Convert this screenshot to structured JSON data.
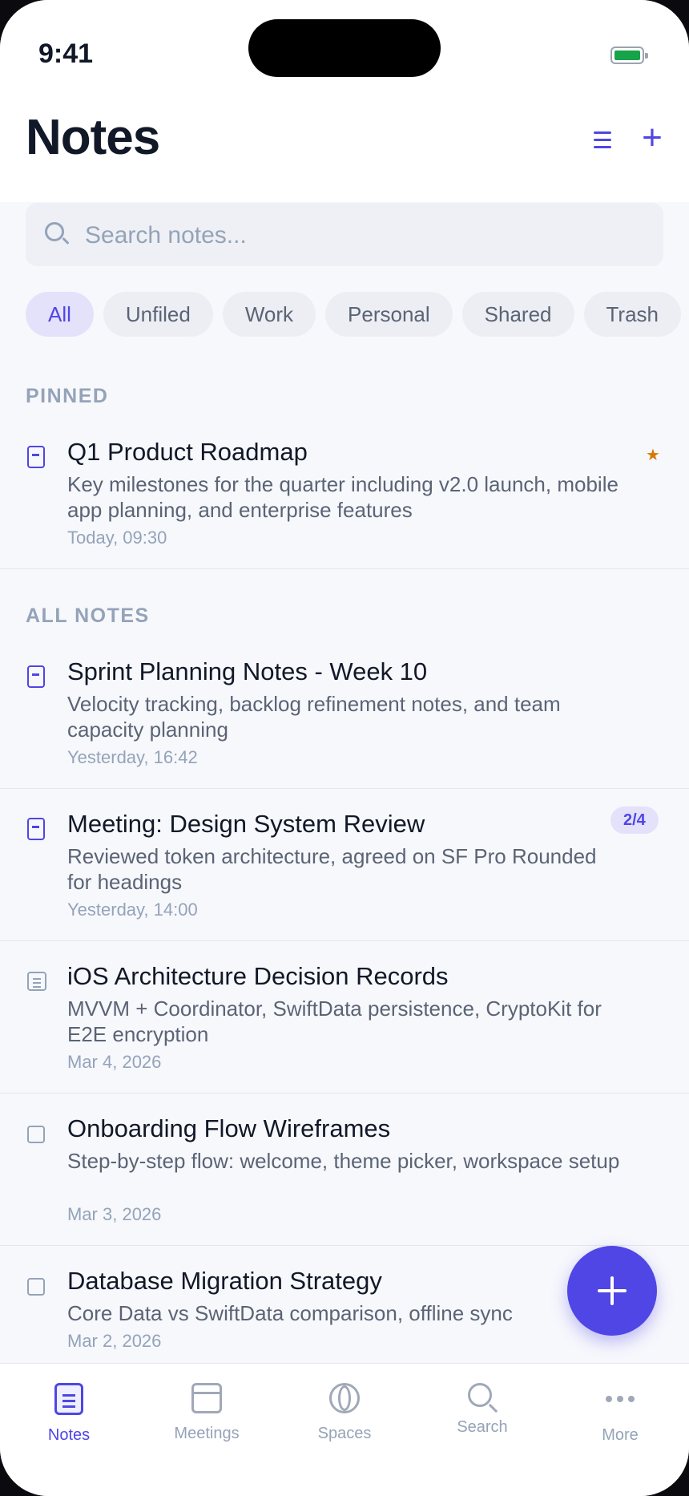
{
  "status": {
    "time": "9:41"
  },
  "header": {
    "title": "Notes",
    "menu_icon": "list-icon",
    "add_icon": "plus-icon"
  },
  "search": {
    "placeholder": "Search notes..."
  },
  "chips": [
    "All",
    "Unfiled",
    "Work",
    "Personal",
    "Shared",
    "Trash"
  ],
  "pinned": {
    "label": "PINNED",
    "notes": [
      {
        "title": "Q1 Product Roadmap",
        "body": "Key milestones for the quarter including v2.0 launch, mobile app planning, and enterprise features",
        "date": "Today, 09:30",
        "pinned": true
      }
    ]
  },
  "all_notes": {
    "label": "ALL NOTES",
    "notes": [
      {
        "title": "Sprint Planning Notes - Week 10",
        "body": "Velocity tracking, backlog refinement notes, and team capacity planning",
        "date": "Yesterday, 16:42"
      },
      {
        "title": "Meeting: Design System Review",
        "body": "Reviewed token architecture, agreed on SF Pro Rounded for headings",
        "date": "Yesterday, 14:00",
        "badge": "2/4"
      },
      {
        "title": "iOS Architecture Decision Records",
        "body": "MVVM + Coordinator, SwiftData persistence, CryptoKit for E2E encryption",
        "date": "Mar 4, 2026"
      },
      {
        "title": "Onboarding Flow Wireframes",
        "body": "Step-by-step flow: welcome, theme picker, workspace setup",
        "date": "Mar 3, 2026"
      },
      {
        "title": "Database Migration Strategy",
        "body": "Core Data vs SwiftData comparison, offline sync",
        "date": "Mar 2, 2026"
      }
    ]
  },
  "tabs": [
    "Notes",
    "Meetings",
    "Spaces",
    "Search",
    "More"
  ],
  "colors": {
    "accent": "#4f46e5",
    "pin": "#d97706",
    "battery": "#16a34a"
  }
}
